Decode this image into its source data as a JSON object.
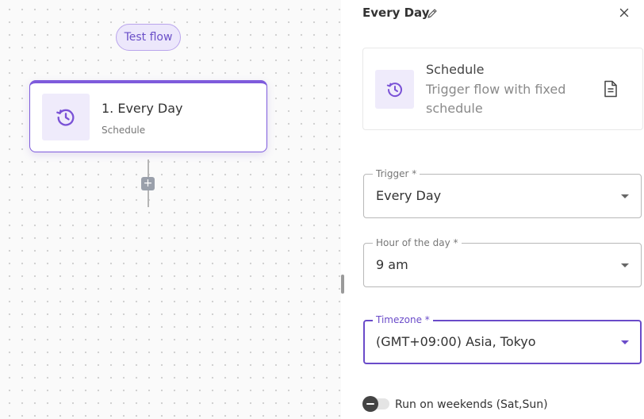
{
  "canvas": {
    "test_flow_label": "Test flow",
    "step": {
      "title": "1. Every Day",
      "subtitle": "Schedule",
      "icon": "schedule-clock-icon"
    },
    "add_step_symbol": "+"
  },
  "panel": {
    "title": "Every Day",
    "trigger_card": {
      "name": "Schedule",
      "description": "Trigger flow with fixed schedule",
      "icon": "schedule-clock-icon",
      "docs_icon": "document-icon"
    },
    "fields": {
      "trigger": {
        "label": "Trigger *",
        "value": "Every Day"
      },
      "hour": {
        "label": "Hour of the day *",
        "value": "9 am"
      },
      "timezone": {
        "label": "Timezone *",
        "value": "(GMT+09:00) Asia, Tokyo"
      }
    },
    "weekends_toggle": {
      "label": "Run on weekends (Sat,Sun)",
      "enabled": false
    }
  },
  "colors": {
    "accent": "#7e5bdc",
    "accent_light": "#efebfb",
    "focused_field": "#6a4bc9"
  }
}
